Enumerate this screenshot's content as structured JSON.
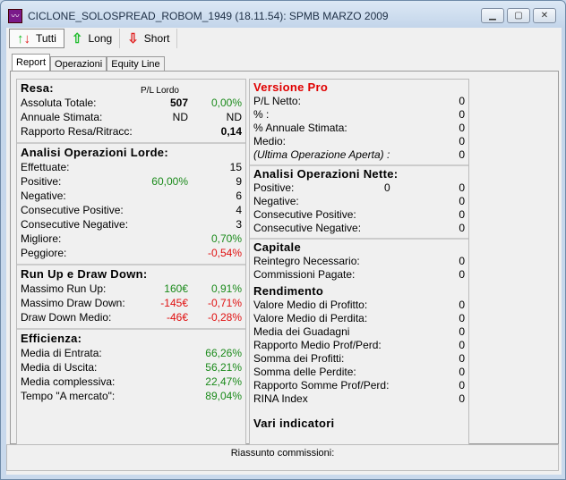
{
  "window": {
    "title": "CICLONE_SOLOSPREAD_ROBOM_1949 (18.11.54): SPMB MARZO 2009",
    "buttons": [
      "minimize",
      "maximize",
      "close"
    ]
  },
  "toolbar": {
    "tutti": "Tutti",
    "long": "Long",
    "short": "Short"
  },
  "tabs": [
    "Report",
    "Operazioni",
    "Equity Line"
  ],
  "resa": {
    "title": "Resa:",
    "col_header": "P/L Lordo",
    "rows": [
      {
        "label": "Assoluta Totale:",
        "mid": "507",
        "val": "0,00%",
        "color": "g",
        "midbold": true
      },
      {
        "label": "Annuale Stimata:",
        "mid": "ND",
        "val": "ND"
      },
      {
        "label": "Rapporto Resa/Ritracc:",
        "mid": "",
        "val": "0,14",
        "bold": true
      }
    ]
  },
  "analisi_lorde": {
    "title": "Analisi Operazioni Lorde:",
    "rows": [
      {
        "label": "Effettuate:",
        "mid": "",
        "val": "15"
      },
      {
        "label": "Positive:",
        "mid": "60,00%",
        "val": "9",
        "midcolor": "g"
      },
      {
        "label": "Negative:",
        "mid": "",
        "val": "6"
      },
      {
        "label": "Consecutive Positive:",
        "mid": "",
        "val": "4"
      },
      {
        "label": "Consecutive Negative:",
        "mid": "",
        "val": "3"
      },
      {
        "label": "Migliore:",
        "mid": "",
        "val": "0,70%",
        "color": "g"
      },
      {
        "label": "Peggiore:",
        "mid": "",
        "val": "-0,54%",
        "color": "r"
      }
    ]
  },
  "runup": {
    "title": "Run Up e Draw Down:",
    "rows": [
      {
        "label": "Massimo Run Up:",
        "mid": "160€",
        "val": "0,91%",
        "color": "g",
        "midcolor": "g"
      },
      {
        "label": "Massimo Draw Down:",
        "mid": "-145€",
        "val": "-0,71%",
        "color": "r",
        "midcolor": "r"
      },
      {
        "label": "Draw Down Medio:",
        "mid": "-46€",
        "val": "-0,28%",
        "color": "r",
        "midcolor": "r"
      }
    ]
  },
  "efficienza": {
    "title": "Efficienza:",
    "rows": [
      {
        "label": "Media di Entrata:",
        "mid": "",
        "val": "66,26%",
        "color": "g"
      },
      {
        "label": "Media di Uscita:",
        "mid": "",
        "val": "56,21%",
        "color": "g"
      },
      {
        "label": "Media complessiva:",
        "mid": "",
        "val": "22,47%",
        "color": "g"
      },
      {
        "label": "Tempo \"A mercato\":",
        "mid": "",
        "val": "89,04%",
        "color": "g"
      }
    ]
  },
  "versione_pro": {
    "title": "Versione Pro",
    "rows": [
      {
        "label": "P/L Netto:",
        "mid": "",
        "val": "0"
      },
      {
        "label": "% :",
        "mid": "",
        "val": "0"
      },
      {
        "label": "% Annuale Stimata:",
        "mid": "",
        "val": "0"
      },
      {
        "label": "Medio:",
        "mid": "",
        "val": "0"
      },
      {
        "label": "(Ultima Operazione Aperta) :",
        "mid": "",
        "val": "0",
        "italic": true
      }
    ]
  },
  "analisi_nette": {
    "title": "Analisi Operazioni Nette:",
    "rows": [
      {
        "label": "Positive:",
        "mid": "0",
        "val": "0"
      },
      {
        "label": "Negative:",
        "mid": "",
        "val": "0"
      },
      {
        "label": "Consecutive Positive:",
        "mid": "",
        "val": "0"
      },
      {
        "label": "Consecutive Negative:",
        "mid": "",
        "val": "0"
      }
    ]
  },
  "capitale": {
    "title": "Capitale",
    "rows": [
      {
        "label": "Reintegro Necessario:",
        "mid": "",
        "val": "0"
      },
      {
        "label": "Commissioni Pagate:",
        "mid": "",
        "val": "0"
      }
    ]
  },
  "rendimento": {
    "title": "Rendimento",
    "rows": [
      {
        "label": "Valore Medio di Profitto:",
        "mid": "",
        "val": "0"
      },
      {
        "label": "Valore Medio di Perdita:",
        "mid": "",
        "val": "0"
      },
      {
        "label": "Media dei Guadagni",
        "mid": "",
        "val": "0"
      },
      {
        "label": "Rapporto Medio Prof/Perd:",
        "mid": "",
        "val": "0"
      },
      {
        "label": "Somma dei Profitti:",
        "mid": "",
        "val": "0"
      },
      {
        "label": "Somma delle Perdite:",
        "mid": "",
        "val": "0"
      },
      {
        "label": "Rapporto Somme Prof/Perd:",
        "mid": "",
        "val": "0"
      },
      {
        "label": "RINA Index",
        "mid": "",
        "val": "0"
      }
    ]
  },
  "vari": {
    "title": "Vari indicatori"
  },
  "status": {
    "text": "Riassunto commissioni:"
  }
}
